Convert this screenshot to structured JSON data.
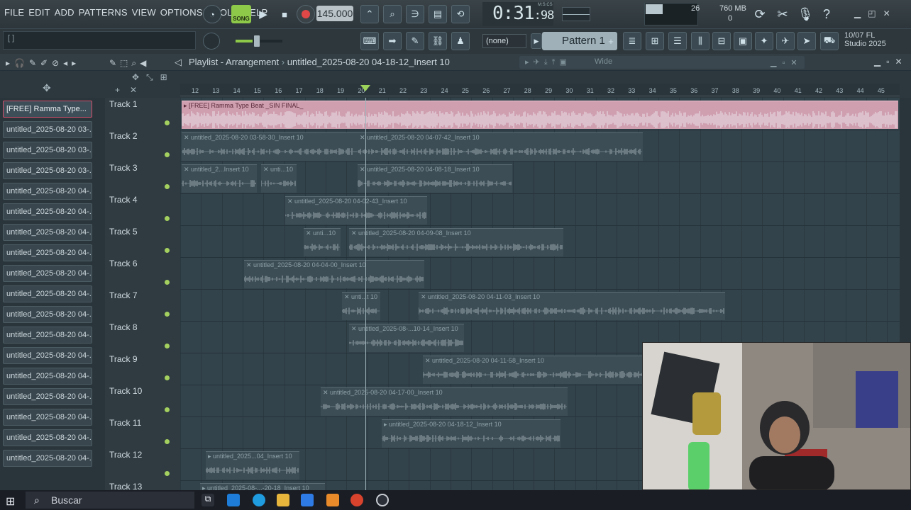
{
  "menu": [
    "FILE",
    "EDIT",
    "ADD",
    "PATTERNS",
    "VIEW",
    "OPTIONS",
    "TOOLS",
    "HELP"
  ],
  "transport": {
    "song_label": "SONG",
    "tempo": "145.000",
    "time_main": "0:31",
    "time_ticks": ":98",
    "time_format": "M:S:CS",
    "cpu_value": "26",
    "memory": "760 MB",
    "memory_sub": "0"
  },
  "toolbar": {
    "hint_text": "[ ]",
    "pattern_selector": "(none)",
    "pattern_label": "Pattern 1",
    "fl_badge_line1": "10/07  FL",
    "fl_badge_line2": "Studio 2025"
  },
  "playlist": {
    "title": "Playlist - Arrangement",
    "separator": "›",
    "mixer_insert": "untitled_2025-08-20 04-18-12_Insert 10",
    "wide_label": "Wide"
  },
  "ruler": [
    "12",
    "13",
    "14",
    "15",
    "16",
    "17",
    "18",
    "19",
    "20",
    "21",
    "22",
    "23",
    "24",
    "25",
    "26",
    "27",
    "28",
    "29",
    "30",
    "31",
    "32",
    "33",
    "34",
    "35",
    "36",
    "37",
    "38",
    "39",
    "40",
    "41",
    "42",
    "43",
    "44",
    "45"
  ],
  "channels": [
    "[FREE] Ramma Type...",
    "untitled_2025-08-20 03-...",
    "untitled_2025-08-20 03-...",
    "untitled_2025-08-20 03-...",
    "untitled_2025-08-20 04-...",
    "untitled_2025-08-20 04-...",
    "untitled_2025-08-20 04-...",
    "untitled_2025-08-20 04-...",
    "untitled_2025-08-20 04-...",
    "untitled_2025-08-20 04-...",
    "untitled_2025-08-20 04-...",
    "untitled_2025-08-20 04-...",
    "untitled_2025-08-20 04-...",
    "untitled_2025-08-20 04-...",
    "untitled_2025-08-20 04-...",
    "untitled_2025-08-20 04-...",
    "untitled_2025-08-20 04-...",
    "untitled_2025-08-20 04-..."
  ],
  "tracks": [
    "Track 1",
    "Track 2",
    "Track 3",
    "Track 4",
    "Track 5",
    "Track 6",
    "Track 7",
    "Track 8",
    "Track 9",
    "Track 10",
    "Track 11",
    "Track 12",
    "Track 13"
  ],
  "clips": [
    {
      "label": "▸ [FREE] Ramma Type Beat _SIN FINAL_",
      "pink": true
    },
    {
      "label": "✕ untitled_2025-08-20 03-58-30_Insert 10"
    },
    {
      "label": "✕ untitled_2025-08-20 04-07-42_Insert 10"
    },
    {
      "label": "✕ untitled_2...Insert 10"
    },
    {
      "label": "✕ unti...10"
    },
    {
      "label": "✕ untitled_2025-08-20 04-08-18_Insert 10"
    },
    {
      "label": "✕ untitled_2025-08-20 04-02-43_Insert 10"
    },
    {
      "label": "✕ unti...10"
    },
    {
      "label": "✕ untitled_2025-08-20 04-09-08_Insert 10"
    },
    {
      "label": "✕ untitled_2025-08-20 04-04-00_Insert 10"
    },
    {
      "label": "✕ unti...t 10"
    },
    {
      "label": "✕ untitled_2025-08-20 04-11-03_Insert 10"
    },
    {
      "label": "✕ untitled_2025-08-...10-14_Insert 10"
    },
    {
      "label": "✕ untitled_2025-08-20 04-11-58_Insert 10"
    },
    {
      "label": "✕ untitled_2025-08-20 04-17-00_Insert 10"
    },
    {
      "label": "▸ untitled_2025-08-20 04-18-12_Insert 10"
    },
    {
      "label": "▸ untitled_2025...04_Insert 10"
    },
    {
      "label": "▸ untitled_2025-08-...-20-18_Insert 10"
    }
  ],
  "taskbar": {
    "search_placeholder": "Buscar"
  }
}
